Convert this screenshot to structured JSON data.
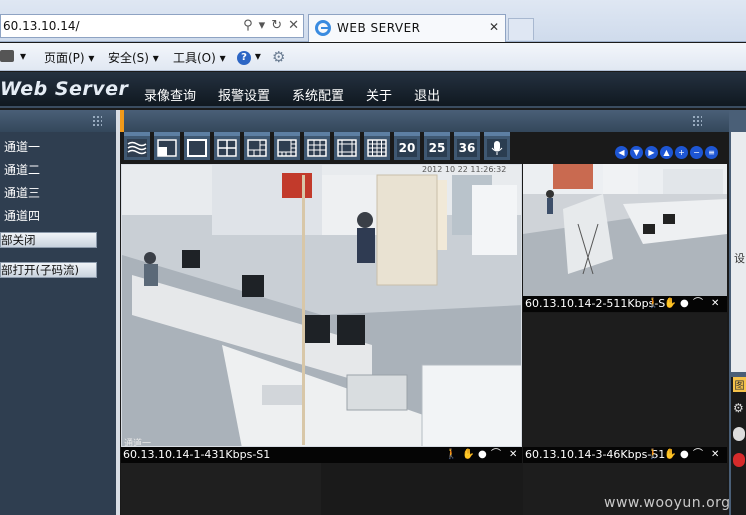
{
  "browser": {
    "address": "60.13.10.14/",
    "tab_title": "WEB SERVER",
    "commands": {
      "page": "页面(P) ▾",
      "security": "安全(S) ▾",
      "tools": "工具(O) ▾"
    }
  },
  "app": {
    "logo": "Web Server",
    "menu": [
      "录像查询",
      "报警设置",
      "系统配置",
      "关于",
      "退出"
    ]
  },
  "sidebar": {
    "channels": [
      "通道一",
      "通道二",
      "通道三",
      "通道四"
    ],
    "close_all": "部关闭",
    "open_all": "部打开(子码流)"
  },
  "layout_buttons": {
    "n20": "20",
    "n25": "25",
    "n36": "36"
  },
  "cameras": {
    "cam1_status": "60.13.10.14-1-431Kbps-S1",
    "cam1_label": "通道一",
    "cam1_timestamp": "2012 10 22 11:26:32",
    "cam2_status": "60.13.10.14-2-511Kbps-S",
    "cam3_status": "60.13.10.14-3-46Kbps-S1"
  },
  "right_partial": {
    "text1": "设",
    "text2": "图"
  },
  "watermark": "www.wooyun.org"
}
